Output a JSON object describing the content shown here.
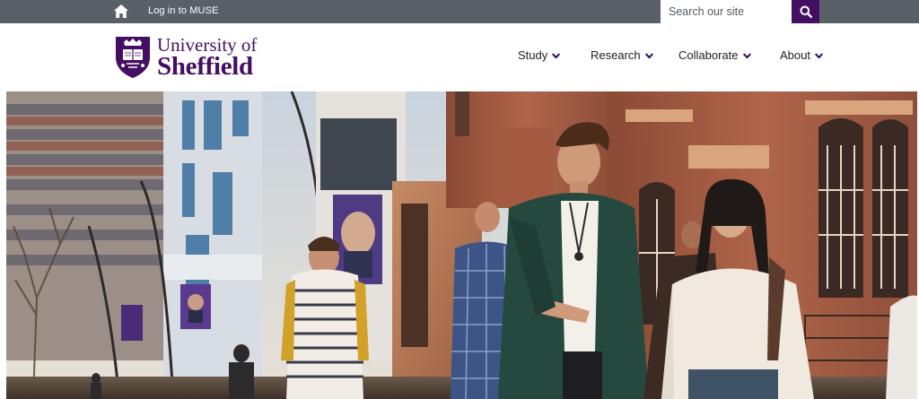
{
  "topbar": {
    "home_icon": "home-icon",
    "muse_link": "Log in to MUSE",
    "search": {
      "placeholder": "Search our site",
      "value": "",
      "button_icon": "search-icon"
    }
  },
  "header": {
    "logo": {
      "line1": "University of",
      "line2": "Sheffield",
      "crest_icon": "university-crest-icon"
    },
    "nav": [
      {
        "label": "Study",
        "icon": "chevron-down-icon"
      },
      {
        "label": "Research",
        "icon": "chevron-down-icon"
      },
      {
        "label": "Collaborate",
        "icon": "chevron-down-icon"
      },
      {
        "label": "About",
        "icon": "chevron-down-icon"
      }
    ]
  },
  "colors": {
    "brand_purple": "#440e62",
    "topbar_grey": "#5a6068",
    "nav_text": "#222222"
  }
}
